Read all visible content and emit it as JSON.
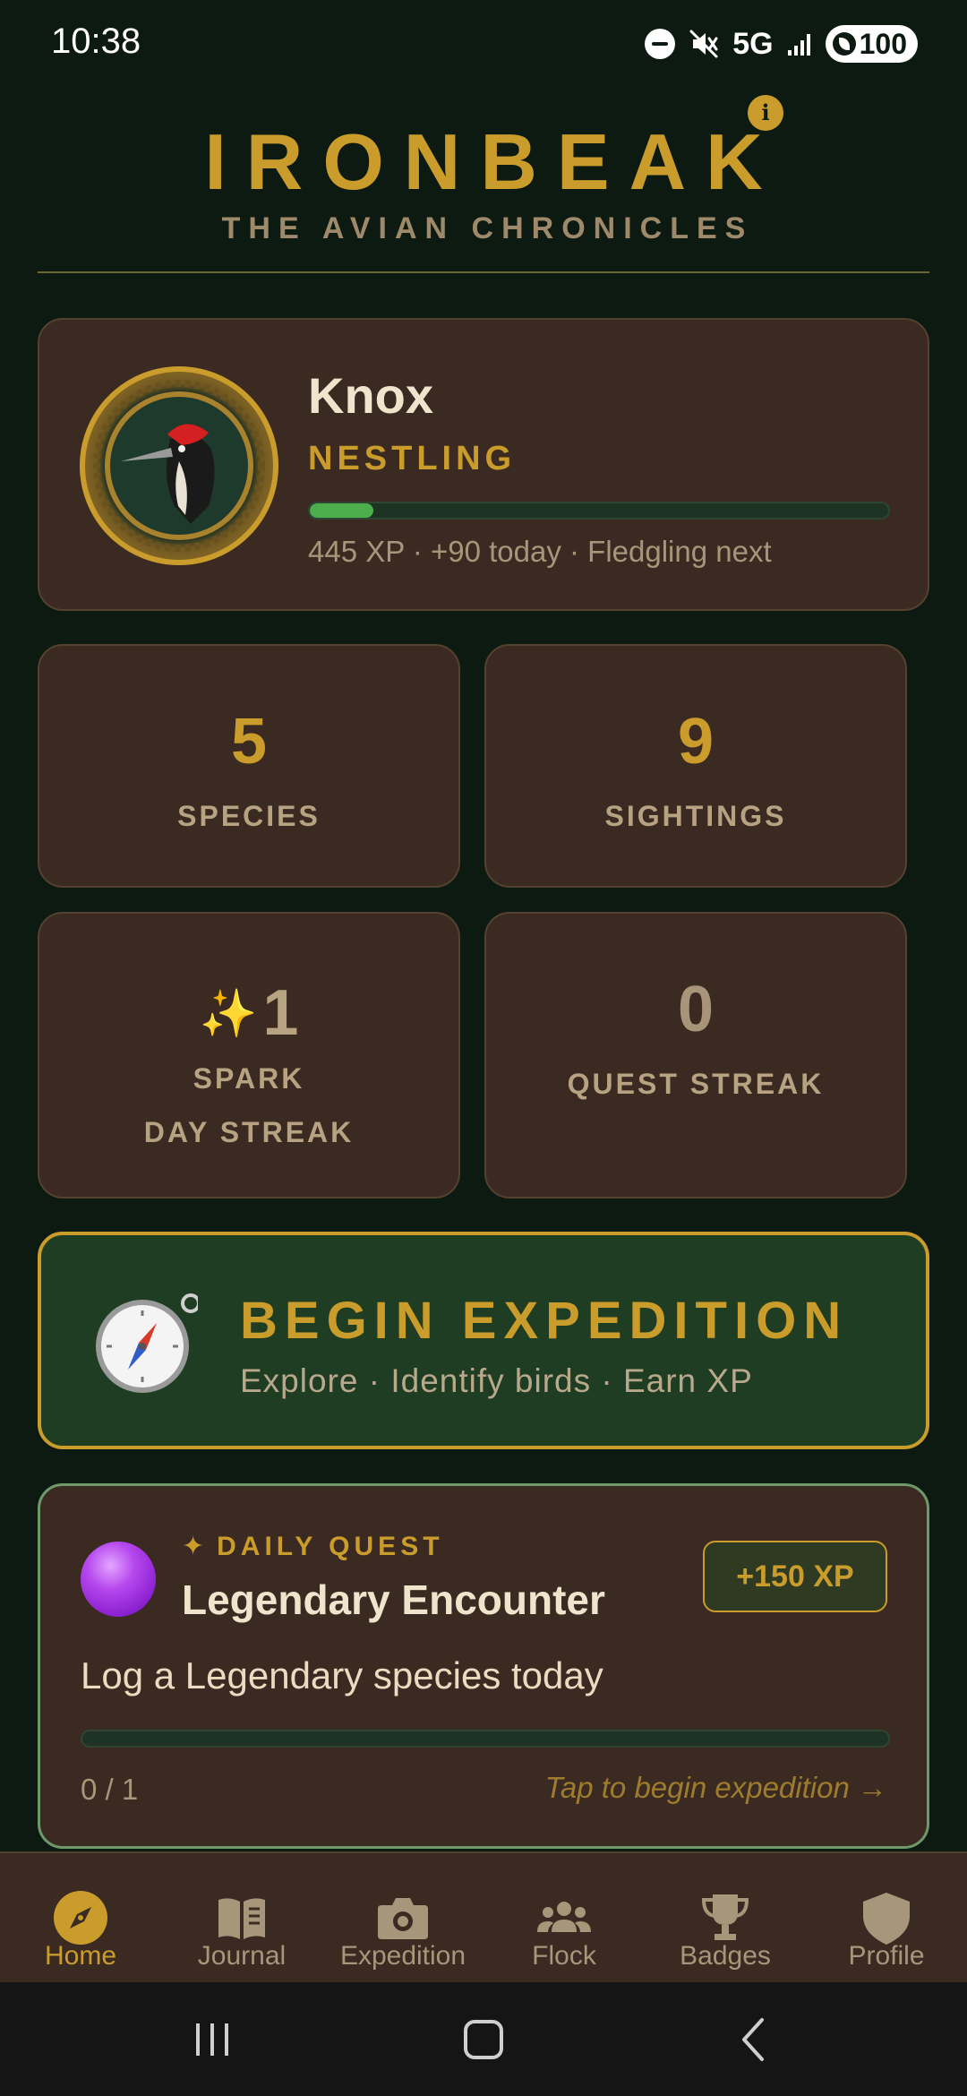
{
  "status_bar": {
    "time": "10:38",
    "network": "5G",
    "battery": "100"
  },
  "header": {
    "title": "IRONBEAK",
    "subtitle": "THE AVIAN CHRONICLES",
    "info_glyph": "i"
  },
  "profile": {
    "name": "Knox",
    "rank": "NESTLING",
    "xp_progress_fraction": 0.11,
    "xp_caption": "445 XP · +90 today · Fledgling next"
  },
  "stats": {
    "species": {
      "value": "5",
      "label": "SPECIES"
    },
    "sightings": {
      "value": "9",
      "label": "SIGHTINGS"
    },
    "spark": {
      "icon": "✨",
      "value": "1",
      "label_top": "SPARK",
      "label_bottom": "DAY STREAK"
    },
    "quest_streak": {
      "value": "0",
      "label": "QUEST STREAK"
    }
  },
  "expedition": {
    "title": "BEGIN EXPEDITION",
    "subtitle": "Explore · Identify birds · Earn XP",
    "icon": "compass-icon"
  },
  "daily_quest": {
    "kicker_icon": "✦",
    "kicker": "DAILY QUEST",
    "title": "Legendary Encounter",
    "reward": "+150 XP",
    "description": "Log a Legendary species today",
    "progress_fraction": 0,
    "progress_text": "0 / 1",
    "cta": "Tap to begin expedition →"
  },
  "nav": {
    "items": [
      {
        "label": "Home",
        "icon": "compass-icon",
        "active": true
      },
      {
        "label": "Journal",
        "icon": "book-icon",
        "active": false
      },
      {
        "label": "Expedition",
        "icon": "camera-icon",
        "active": false
      },
      {
        "label": "Flock",
        "icon": "group-icon",
        "active": false
      },
      {
        "label": "Badges",
        "icon": "trophy-icon",
        "active": false
      },
      {
        "label": "Profile",
        "icon": "shield-icon",
        "active": false
      }
    ]
  },
  "colors": {
    "background": "#0c1a12",
    "accent_gold": "#c99c2c",
    "card_brown": "#3b2a22",
    "expedition_green": "#1f3d22",
    "progress_green": "#4cae4c"
  }
}
